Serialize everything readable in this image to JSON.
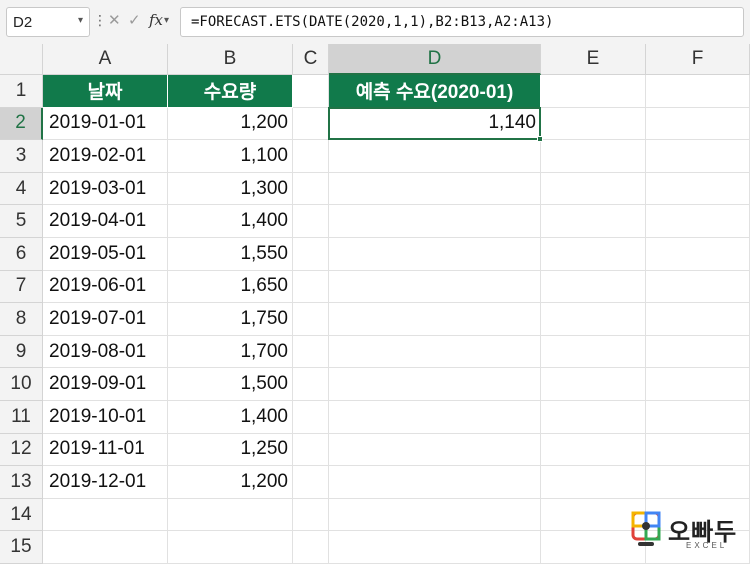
{
  "formula_bar": {
    "name_box": "D2",
    "fx_label": "fx",
    "formula": "=FORECAST.ETS(DATE(2020,1,1),B2:B13,A2:A13)"
  },
  "columns": [
    "A",
    "B",
    "C",
    "D",
    "E",
    "F"
  ],
  "selected_column": "D",
  "rows": [
    "1",
    "2",
    "3",
    "4",
    "5",
    "6",
    "7",
    "8",
    "9",
    "10",
    "11",
    "12",
    "13",
    "14",
    "15"
  ],
  "selected_row": "2",
  "table": {
    "headers": [
      "날짜",
      "수요량"
    ],
    "dates": [
      "2019-01-01",
      "2019-02-01",
      "2019-03-01",
      "2019-04-01",
      "2019-05-01",
      "2019-06-01",
      "2019-07-01",
      "2019-08-01",
      "2019-09-01",
      "2019-10-01",
      "2019-11-01",
      "2019-12-01"
    ],
    "demand": [
      "1,200",
      "1,100",
      "1,300",
      "1,400",
      "1,550",
      "1,650",
      "1,750",
      "1,700",
      "1,500",
      "1,400",
      "1,250",
      "1,200"
    ]
  },
  "forecast": {
    "header": "예측 수요(2020-01)",
    "value": "1,140"
  },
  "watermark": {
    "brand": "오빠두",
    "sub": "EXCEL"
  },
  "colors": {
    "header_fill": "#117a4b",
    "selection": "#217346"
  }
}
